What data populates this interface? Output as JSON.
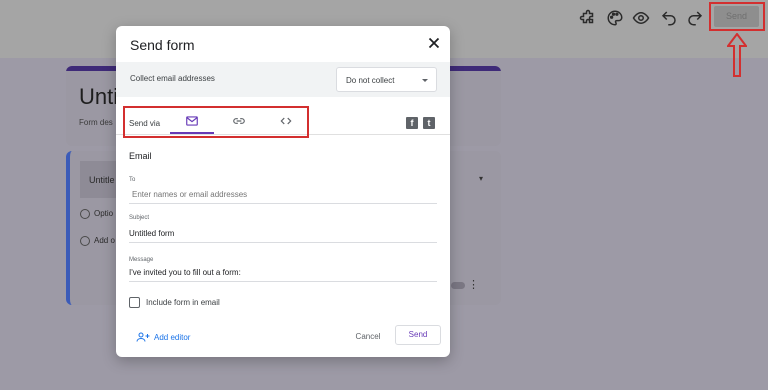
{
  "toolbar": {
    "send_label": "Send",
    "icons": [
      "puzzle-icon",
      "palette-icon",
      "eye-icon",
      "undo-icon",
      "redo-icon"
    ]
  },
  "form": {
    "title": "Untit",
    "description": "Form des",
    "question_title": "Untitle",
    "option1": "Optio",
    "option2": "Add o"
  },
  "dialog": {
    "title": "Send form",
    "collect": {
      "label": "Collect email addresses",
      "value": "Do not collect"
    },
    "send_via": {
      "label": "Send via",
      "tabs": [
        "email-icon",
        "link-icon",
        "embed-icon"
      ],
      "active_tab": "email-icon"
    },
    "email": {
      "section_title": "Email",
      "to_label": "To",
      "to_placeholder": "Enter names or email addresses",
      "subject_label": "Subject",
      "subject_value": "Untitled form",
      "message_label": "Message",
      "message_value": "I've invited you to fill out a form:",
      "include_label": "Include form in email"
    },
    "footer": {
      "add_editor_label": "Add editor",
      "cancel_label": "Cancel",
      "send_label": "Send"
    }
  },
  "colors": {
    "accent": "#673ab7",
    "link": "#1a73e8",
    "highlight": "#d32f2f"
  }
}
